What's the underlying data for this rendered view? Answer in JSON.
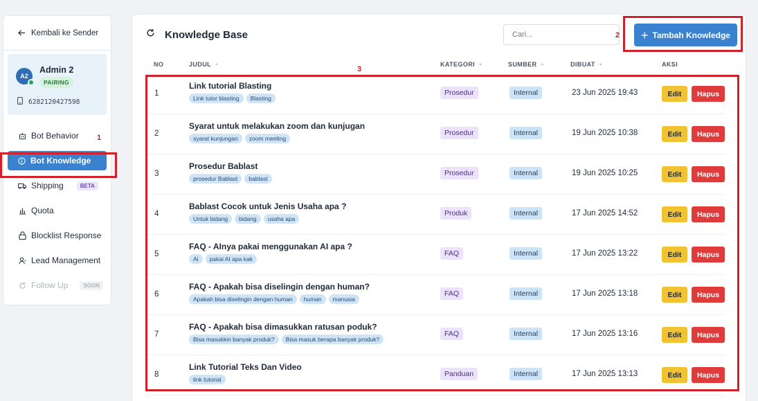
{
  "sidebar": {
    "back_label": "Kembali ke Sender",
    "profile": {
      "initials": "A2",
      "name": "Admin 2",
      "status": "PAIRING",
      "phone": "6282120427598"
    },
    "items": [
      {
        "label": "Bot Behavior",
        "icon": "robot-icon"
      },
      {
        "label": "Bot Knowledge",
        "icon": "info-circle-icon"
      },
      {
        "label": "Shipping",
        "icon": "truck-icon",
        "badge": "BETA"
      },
      {
        "label": "Quota",
        "icon": "bar-chart-icon"
      },
      {
        "label": "Blocklist Response",
        "icon": "lock-icon"
      },
      {
        "label": "Lead Management",
        "icon": "user-icon"
      },
      {
        "label": "Follow Up",
        "icon": "refresh-icon",
        "badge": "SOON"
      }
    ]
  },
  "main": {
    "title": "Knowledge Base",
    "search_placeholder": "Cari...",
    "add_button": "Tambah Knowledge",
    "columns": {
      "no": "NO",
      "judul": "JUDUL",
      "kategori": "KATEGORI",
      "sumber": "SUMBER",
      "dibuat": "DIBUAT",
      "aksi": "AKSI"
    },
    "edit_label": "Edit",
    "delete_label": "Hapus",
    "rows": [
      {
        "no": "1",
        "title": "Link tutorial Blasting",
        "tags": [
          "Link tutor blasting",
          "Blasting"
        ],
        "kategori": "Prosedur",
        "sumber": "Internal",
        "dibuat": "23 Jun 2025 19:43"
      },
      {
        "no": "2",
        "title": "Syarat untuk melakukan zoom dan kunjugan",
        "tags": [
          "syarat kunjungan",
          "zoom meeting"
        ],
        "kategori": "Prosedur",
        "sumber": "Internal",
        "dibuat": "19 Jun 2025 10:38"
      },
      {
        "no": "3",
        "title": "Prosedur Bablast",
        "tags": [
          "prosedur Bablast",
          "bablast"
        ],
        "kategori": "Prosedur",
        "sumber": "Internal",
        "dibuat": "19 Jun 2025 10:25"
      },
      {
        "no": "4",
        "title": "Bablast Cocok untuk Jenis Usaha apa ?",
        "tags": [
          "Untuk bidang",
          "bidang",
          "usaha apa"
        ],
        "kategori": "Produk",
        "sumber": "Internal",
        "dibuat": "17 Jun 2025 14:52"
      },
      {
        "no": "5",
        "title": "FAQ - AInya pakai menggunakan AI apa ?",
        "tags": [
          "Ai",
          "pakai AI apa kak"
        ],
        "kategori": "FAQ",
        "sumber": "Internal",
        "dibuat": "17 Jun 2025 13:22"
      },
      {
        "no": "6",
        "title": "FAQ - Apakah bisa diselingin dengan human?",
        "tags": [
          "Apakah bisa diselingin dengan human",
          "human",
          "manusia"
        ],
        "kategori": "FAQ",
        "sumber": "Internal",
        "dibuat": "17 Jun 2025 13:18"
      },
      {
        "no": "7",
        "title": "FAQ - Apakah bisa dimasukkan ratusan poduk?",
        "tags": [
          "Bisa masukkin banyak produk?",
          "Bisa masuk berapa banyak produk?"
        ],
        "kategori": "FAQ",
        "sumber": "Internal",
        "dibuat": "17 Jun 2025 13:16"
      },
      {
        "no": "8",
        "title": "Link Tutorial Teks Dan Video",
        "tags": [
          "link tutorial"
        ],
        "kategori": "Panduan",
        "sumber": "Internal",
        "dibuat": "17 Jun 2025 13:13"
      }
    ]
  },
  "annotations": [
    "1",
    "2",
    "3"
  ],
  "colors": {
    "accent": "#3a82cf",
    "annotation": "#d0202a",
    "edit": "#f1c232",
    "delete": "#e03b3b"
  }
}
